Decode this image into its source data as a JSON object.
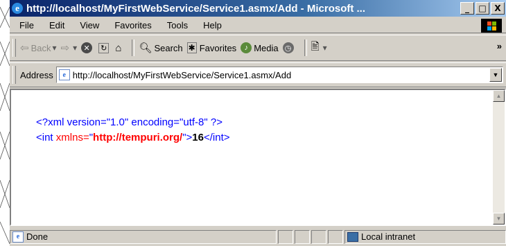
{
  "window": {
    "title": "http://localhost/MyFirstWebService/Service1.asmx/Add - Microsoft ...",
    "controls": {
      "minimize": "_",
      "maximize": "□",
      "close": "X"
    }
  },
  "menu": {
    "items": [
      "File",
      "Edit",
      "View",
      "Favorites",
      "Tools",
      "Help"
    ]
  },
  "toolbar": {
    "back": "Back",
    "search": "Search",
    "favorites": "Favorites",
    "media": "Media",
    "more": "»"
  },
  "address": {
    "label": "Address",
    "url": "http://localhost/MyFirstWebService/Service1.asmx/Add"
  },
  "document": {
    "declaration": "<?xml version=\"1.0\" encoding=\"utf-8\" ?>",
    "open_tag": "<int",
    "attr_name": "xmlns=",
    "attr_quote_open": "\"",
    "attr_value": "http://tempuri.org/",
    "attr_quote_close": "\">",
    "value": "16",
    "close_tag": "</int>"
  },
  "status": {
    "left": "Done",
    "zone": "Local intranet"
  },
  "colors": {
    "titlebar": "#0a246a",
    "chrome": "#d4d0c8",
    "xml_markup": "#0000ff",
    "xml_attr": "#ff0000"
  },
  "icons": [
    "ie-icon",
    "back-arrow-icon",
    "forward-arrow-icon",
    "stop-icon",
    "refresh-icon",
    "home-icon",
    "search-icon",
    "favorites-icon",
    "media-icon",
    "history-icon",
    "mail-icon",
    "page-icon",
    "zone-icon"
  ]
}
